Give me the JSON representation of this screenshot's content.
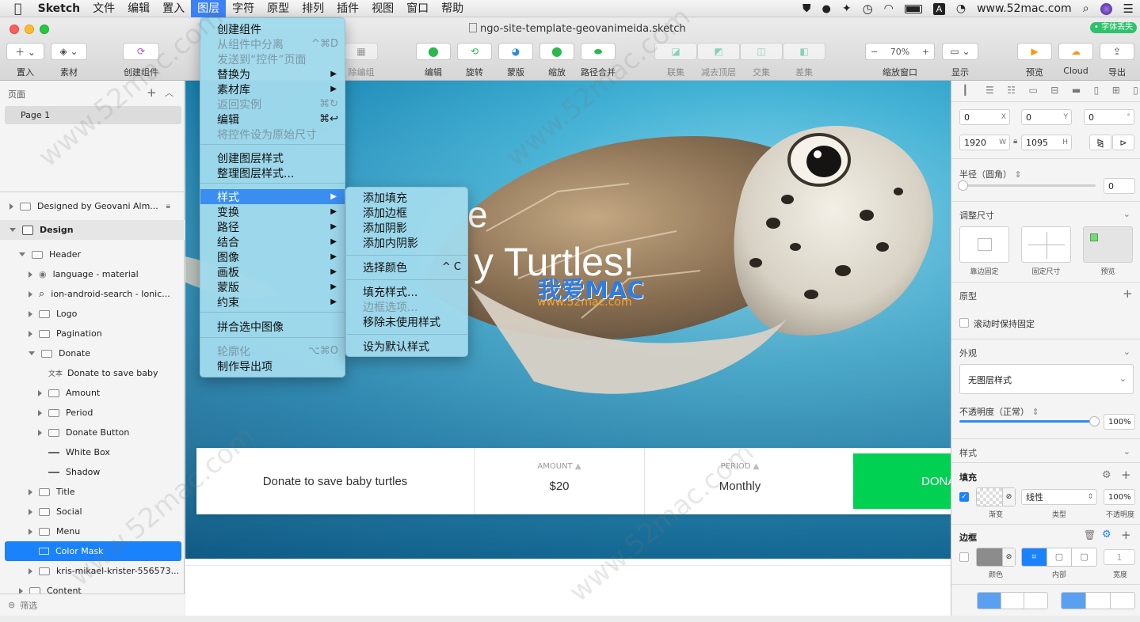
{
  "menubar": {
    "app": "Sketch",
    "items": [
      "文件",
      "编辑",
      "置入",
      "图层",
      "字符",
      "原型",
      "排列",
      "插件",
      "视图",
      "窗口",
      "帮助"
    ],
    "active_index": 3,
    "site": "www.52mac.com"
  },
  "window": {
    "title": "ngo-site-template-geovanimeida.sketch",
    "badge": "• 字体丢失"
  },
  "toolbar": {
    "insert": "置入",
    "assets": "素材",
    "create_symbol": "创建组件",
    "ungroup": "除编组",
    "edit": "编辑",
    "rotate": "旋转",
    "mask": "蒙版",
    "scale": "缩放",
    "path_merge": "路径合并",
    "union": "联集",
    "subtract": "减去顶层",
    "intersect": "交集",
    "difference": "差集",
    "zoom_value": "70%",
    "zoom_label": "缩放窗口",
    "display": "显示",
    "preview": "预览",
    "cloud": "Cloud",
    "export": "导出",
    "minus": "−",
    "plus": "+"
  },
  "layers": {
    "pages_label": "页面",
    "page1": "Page 1",
    "filter": "筛选",
    "rows": [
      {
        "label": "Designed by Geovani Alm...",
        "indent": 0,
        "kind": "folder",
        "expanded": false
      },
      {
        "label": "Design",
        "indent": 0,
        "kind": "artboard",
        "expanded": true
      },
      {
        "label": "Header",
        "indent": 1,
        "kind": "folder",
        "expanded": true
      },
      {
        "label": "language - material",
        "indent": 2,
        "kind": "symbol",
        "expanded": false
      },
      {
        "label": "ion-android-search - Ionic...",
        "indent": 2,
        "kind": "search",
        "expanded": false
      },
      {
        "label": "Logo",
        "indent": 2,
        "kind": "folder",
        "expanded": false
      },
      {
        "label": "Pagination",
        "indent": 2,
        "kind": "folder",
        "expanded": false
      },
      {
        "label": "Donate",
        "indent": 2,
        "kind": "folder",
        "expanded": true
      },
      {
        "label": "Donate to save baby",
        "indent": 3,
        "kind": "text",
        "expanded": null
      },
      {
        "label": "Amount",
        "indent": 3,
        "kind": "folder",
        "expanded": false
      },
      {
        "label": "Period",
        "indent": 3,
        "kind": "folder",
        "expanded": false
      },
      {
        "label": "Donate Button",
        "indent": 3,
        "kind": "folder",
        "expanded": false
      },
      {
        "label": "White Box",
        "indent": 3,
        "kind": "line",
        "expanded": null
      },
      {
        "label": "Shadow",
        "indent": 3,
        "kind": "line",
        "expanded": null
      },
      {
        "label": "Title",
        "indent": 2,
        "kind": "folder",
        "expanded": false
      },
      {
        "label": "Social",
        "indent": 2,
        "kind": "folder",
        "expanded": false
      },
      {
        "label": "Menu",
        "indent": 2,
        "kind": "folder",
        "expanded": false
      },
      {
        "label": "Color Mask",
        "indent": 2,
        "kind": "rect",
        "expanded": null,
        "selected": true
      },
      {
        "label": "kris-mikael-krister-556573...",
        "indent": 2,
        "kind": "folder",
        "expanded": false
      },
      {
        "label": "Content",
        "indent": 1,
        "kind": "folder",
        "expanded": false
      }
    ],
    "text_icon": "文本"
  },
  "layer_menu": {
    "items": [
      {
        "label": "创建组件",
        "shortcut": "",
        "disabled": false,
        "submenu": false
      },
      {
        "label": "从组件中分离",
        "shortcut": "^⌘D",
        "disabled": true,
        "submenu": false
      },
      {
        "label": "发送到“控件”页面",
        "shortcut": "",
        "disabled": true,
        "submenu": false
      },
      {
        "label": "替换为",
        "shortcut": "",
        "disabled": false,
        "submenu": true
      },
      {
        "label": "素材库",
        "shortcut": "",
        "disabled": false,
        "submenu": true
      },
      {
        "label": "返回实例",
        "shortcut": "⌘↻",
        "disabled": true,
        "submenu": false
      },
      {
        "label": "编辑",
        "shortcut": "⌘↩",
        "disabled": false,
        "submenu": false
      },
      {
        "label": "将控件设为原始尺寸",
        "shortcut": "",
        "disabled": true,
        "submenu": false
      },
      {
        "label": "创建图层样式",
        "shortcut": "",
        "disabled": false,
        "submenu": false
      },
      {
        "label": "整理图层样式...",
        "shortcut": "",
        "disabled": false,
        "submenu": false
      },
      {
        "label": "样式",
        "shortcut": "",
        "disabled": false,
        "submenu": true,
        "highlight": true
      },
      {
        "label": "变换",
        "shortcut": "",
        "disabled": false,
        "submenu": true
      },
      {
        "label": "路径",
        "shortcut": "",
        "disabled": false,
        "submenu": true
      },
      {
        "label": "结合",
        "shortcut": "",
        "disabled": false,
        "submenu": true
      },
      {
        "label": "图像",
        "shortcut": "",
        "disabled": false,
        "submenu": true
      },
      {
        "label": "画板",
        "shortcut": "",
        "disabled": false,
        "submenu": true
      },
      {
        "label": "蒙版",
        "shortcut": "",
        "disabled": false,
        "submenu": true
      },
      {
        "label": "约束",
        "shortcut": "",
        "disabled": false,
        "submenu": true
      },
      {
        "label": "拼合选中图像",
        "shortcut": "",
        "disabled": false,
        "submenu": false
      },
      {
        "label": "轮廓化",
        "shortcut": "⌥⌘O",
        "disabled": true,
        "submenu": false
      },
      {
        "label": "制作导出项",
        "shortcut": "",
        "disabled": false,
        "submenu": false
      }
    ]
  },
  "style_submenu": {
    "items": [
      {
        "label": "添加填充",
        "shortcut": "",
        "disabled": false
      },
      {
        "label": "添加边框",
        "shortcut": "",
        "disabled": false
      },
      {
        "label": "添加阴影",
        "shortcut": "",
        "disabled": false
      },
      {
        "label": "添加内阴影",
        "shortcut": "",
        "disabled": false
      },
      {
        "label": "选择颜色",
        "shortcut": "^ C",
        "disabled": false
      },
      {
        "label": "填充样式...",
        "shortcut": "",
        "disabled": false
      },
      {
        "label": "边框选项...",
        "shortcut": "",
        "disabled": true
      },
      {
        "label": "移除未使用样式",
        "shortcut": "",
        "disabled": false
      },
      {
        "label": "设为默认样式",
        "shortcut": "",
        "disabled": false
      }
    ]
  },
  "canvas": {
    "hero_text_1": "e",
    "hero_text_2": "y Turtles!",
    "watermark_brand": "我爱MAC",
    "watermark_url": "www.52mac.com",
    "donate_text": "Donate to save baby turtles",
    "amount_label": "AMOUNT",
    "amount_value": "$20",
    "period_label": "PERIOD",
    "period_value": "Monthly",
    "donate_button": "DONAT",
    "accent_green": "#00d153"
  },
  "inspector": {
    "x": "0",
    "x_sfx": "X",
    "y": "0",
    "y_sfx": "Y",
    "rot": "0",
    "rot_sfx": "°",
    "w": "1920",
    "w_sfx": "W",
    "h": "1095",
    "h_sfx": "H",
    "radius_label": "半径（圆角）",
    "radius_value": "0",
    "resize_label": "调整尺寸",
    "pin_edge": "靠边固定",
    "fix_size": "固定尺寸",
    "preview": "预览",
    "prototype_label": "原型",
    "fix_on_scroll": "滚动时保持固定",
    "appearance_label": "外观",
    "layer_style": "无图层样式",
    "opacity_label": "不透明度（正常）",
    "opacity_value": "100%",
    "style_label": "样式",
    "fill_label": "填充",
    "fill_type": "线性",
    "fill_opacity": "100%",
    "fill_caption_gradient": "渐变",
    "fill_caption_type": "类型",
    "fill_caption_opacity": "不透明度",
    "border_label": "边框",
    "border_caption_color": "颜色",
    "border_caption_pos": "内部",
    "border_caption_width": "宽度",
    "border_width": "1",
    "border_color": "#8c8c8c",
    "accent_blue": "#1a82fb"
  },
  "watermark": "www.52mac.com"
}
